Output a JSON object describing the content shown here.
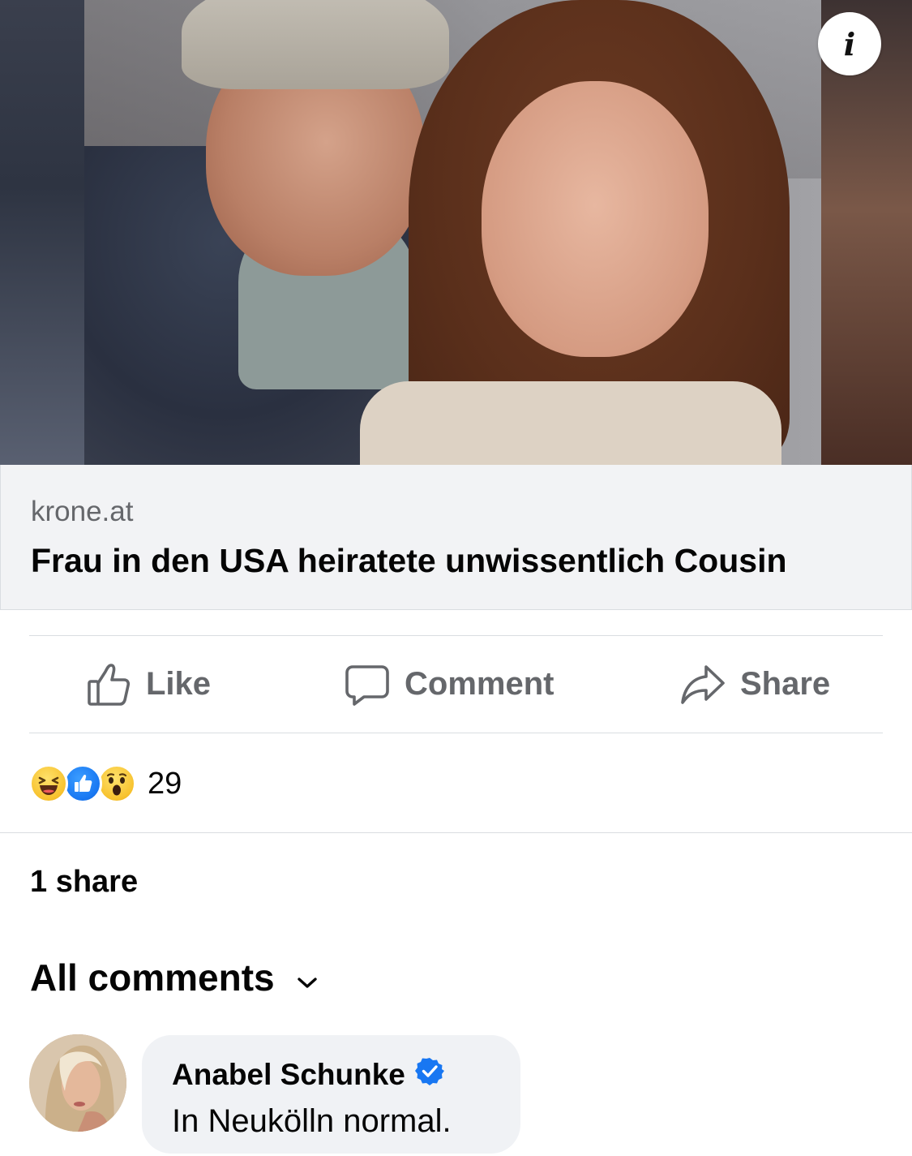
{
  "post": {
    "image_alt": "Photo of a smiling couple, a man in a cap and a woman with long brown hair"
  },
  "info_icon": "info-icon",
  "link_preview": {
    "domain": "krone.at",
    "title": "Frau in den USA heiratete unwissentlich Cousin"
  },
  "actions": {
    "like_label": "Like",
    "comment_label": "Comment",
    "share_label": "Share"
  },
  "reactions": {
    "icons": [
      "haha-reaction-icon",
      "like-reaction-icon",
      "wow-reaction-icon"
    ],
    "count": "29"
  },
  "shares_text": "1 share",
  "comments_filter": {
    "label": "All comments"
  },
  "comments": [
    {
      "author": "Anabel Schunke",
      "verified": true,
      "text": "In Neukölln normal."
    }
  ],
  "colors": {
    "secondary_text": "#65676b",
    "primary_text": "#050505",
    "link_box_bg": "#f2f3f5",
    "comment_bubble_bg": "#f0f2f5",
    "verified_blue": "#1877f2"
  }
}
